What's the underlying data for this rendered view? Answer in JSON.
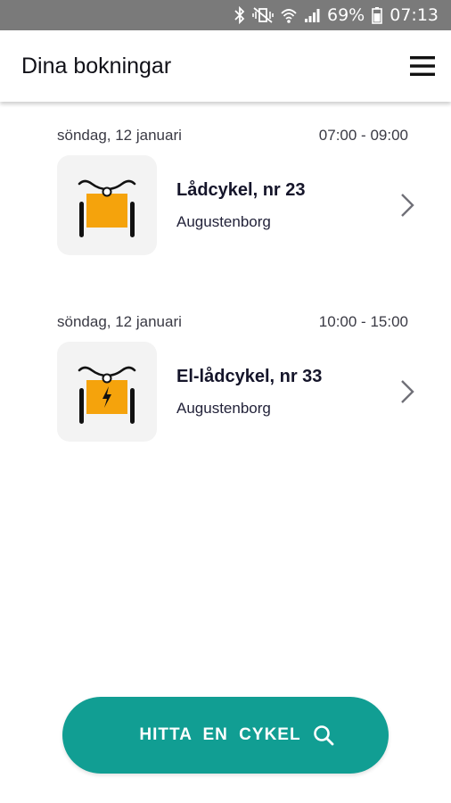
{
  "status_bar": {
    "battery_percent": "69%",
    "time": "07:13",
    "icons": [
      "bluetooth-icon",
      "vibrate-mute-icon",
      "wifi-icon",
      "signal-icon",
      "battery-icon"
    ]
  },
  "header": {
    "title": "Dina bokningar",
    "menu_icon": "hamburger-menu-icon"
  },
  "bookings": [
    {
      "date": "söndag, 12 januari",
      "time": "07:00 - 09:00",
      "bike_name": "Lådcykel, nr 23",
      "location": "Augustenborg",
      "icon": "cargo-bike-icon"
    },
    {
      "date": "söndag, 12 januari",
      "time": "10:00 - 15:00",
      "bike_name": "El-lådcykel, nr 33",
      "location": "Augustenborg",
      "icon": "electric-cargo-bike-icon"
    }
  ],
  "cta": {
    "label": "HITTA EN CYKEL",
    "icon": "search-icon"
  },
  "colors": {
    "accent": "#119e93",
    "bike_box": "#f5a30c",
    "status_bar": "#7a7a7a"
  }
}
